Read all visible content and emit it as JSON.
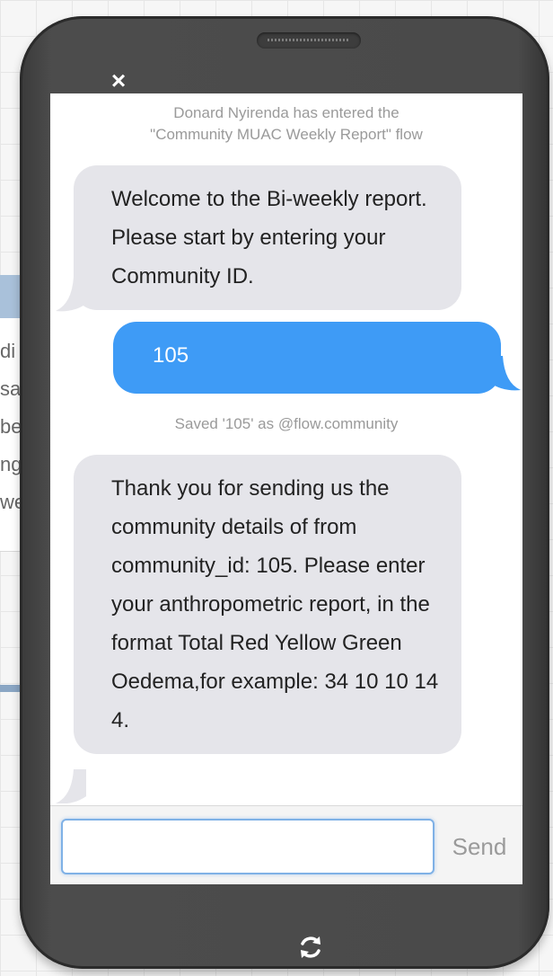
{
  "background_fragments": [
    "di",
    "sa",
    "be",
    "ng",
    "we"
  ],
  "phone": {
    "close_symbol": "×",
    "refresh_icon": "refresh-icon"
  },
  "chat": {
    "system_notes": {
      "flow_entered": "Donard Nyirenda has entered the \"Community MUAC Weekly Report\" flow",
      "saved": "Saved '105' as @flow.community"
    },
    "messages": [
      {
        "direction": "incoming",
        "text": "Welcome to the Bi-weekly report. Please start by entering your Community ID."
      },
      {
        "direction": "outgoing",
        "text": "105"
      },
      {
        "direction": "incoming",
        "text": "Thank you for sending us the community details of from community_id: 105. Please enter your anthropometric report, in the format Total Red Yellow Green Oedema,for example: 34 10 10 14 4."
      }
    ]
  },
  "composer": {
    "input_value": "",
    "input_placeholder": "",
    "send_label": "Send"
  },
  "colors": {
    "incoming_bubble": "#e5e5ea",
    "outgoing_bubble": "#3e9bf6",
    "phone_body": "#4a4a4a",
    "input_focus_border": "#7fb1e6"
  }
}
